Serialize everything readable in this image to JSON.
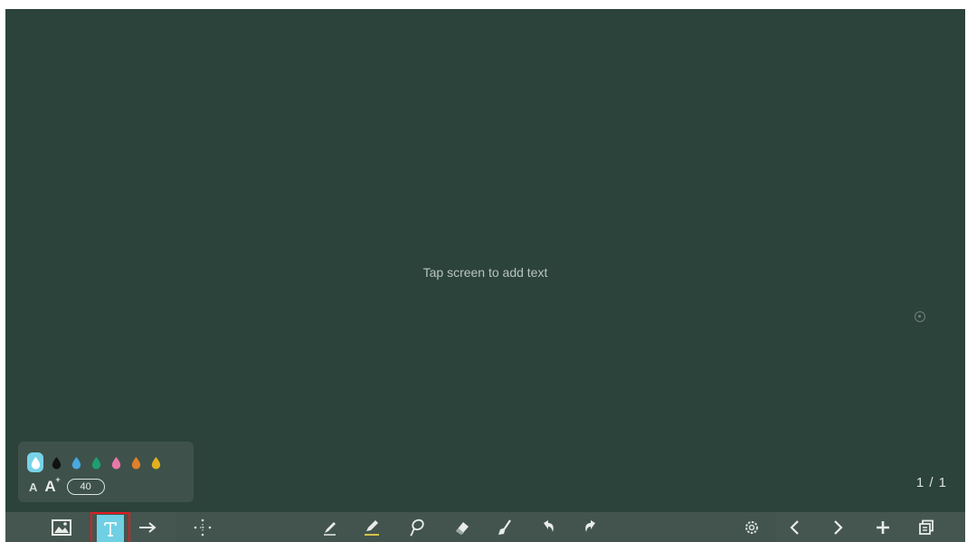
{
  "canvas": {
    "hint": "Tap screen to add text",
    "background_color": "#2b433b"
  },
  "page_indicator": "1 / 1",
  "text_panel": {
    "colors": [
      {
        "name": "white",
        "hex": "#ffffff",
        "selected": true
      },
      {
        "name": "black",
        "hex": "#111111",
        "selected": false
      },
      {
        "name": "blue",
        "hex": "#4aa8e0",
        "selected": false
      },
      {
        "name": "green",
        "hex": "#1f9e72",
        "selected": false
      },
      {
        "name": "pink",
        "hex": "#e878a8",
        "selected": false
      },
      {
        "name": "orange",
        "hex": "#e0802a",
        "selected": false
      },
      {
        "name": "yellow",
        "hex": "#e0b020",
        "selected": false
      }
    ],
    "font_decrease_label": "A",
    "font_increase_label": "A",
    "font_increase_sup": "+",
    "font_size": "40"
  },
  "toolbar": {
    "tools": [
      {
        "name": "image-tool",
        "icon": "image-icon"
      },
      {
        "name": "text-tool",
        "icon": "text-icon",
        "active": true
      },
      {
        "name": "arrow-tool",
        "icon": "arrow-right-icon"
      },
      {
        "name": "move-tool",
        "icon": "move-icon"
      },
      {
        "name": "pen-tool",
        "icon": "pen-icon"
      },
      {
        "name": "highlighter-tool",
        "icon": "highlighter-icon"
      },
      {
        "name": "lasso-tool",
        "icon": "lasso-icon"
      },
      {
        "name": "eraser-tool",
        "icon": "eraser-icon"
      },
      {
        "name": "clear-tool",
        "icon": "broom-icon"
      },
      {
        "name": "undo-tool",
        "icon": "undo-icon"
      },
      {
        "name": "redo-tool",
        "icon": "redo-icon"
      },
      {
        "name": "settings-tool",
        "icon": "gear-icon"
      },
      {
        "name": "previous-page",
        "icon": "chevron-left-icon"
      },
      {
        "name": "next-page",
        "icon": "chevron-right-icon"
      },
      {
        "name": "add-page",
        "icon": "plus-icon"
      },
      {
        "name": "pages-overview",
        "icon": "pages-icon"
      }
    ],
    "active_color": "#6fd0e3",
    "highlight_border_color": "#e21c23"
  }
}
